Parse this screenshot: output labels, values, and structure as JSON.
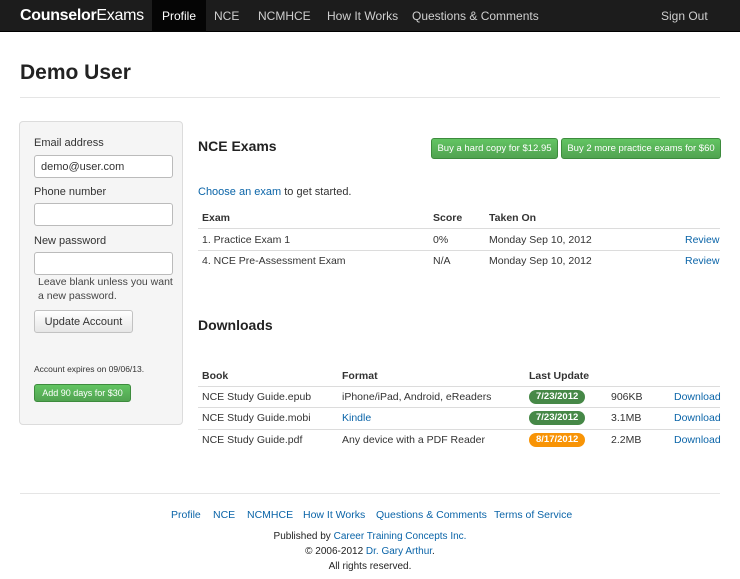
{
  "brand": {
    "bold": "Counselor",
    "light": "Exams"
  },
  "nav": {
    "items": [
      "Profile",
      "NCE",
      "NCMHCE",
      "How It Works",
      "Questions & Comments"
    ],
    "sign_out": "Sign Out"
  },
  "page_title": "Demo User",
  "account_form": {
    "email_label": "Email address",
    "email_value": "demo@user.com",
    "phone_label": "Phone number",
    "phone_value": "",
    "password_label": "New password",
    "password_value": "",
    "password_help": "Leave blank unless you want a new password.",
    "update_button": "Update Account",
    "expires_text": "Account expires on 09/06/13.",
    "add_days_button": "Add 90 days for $30"
  },
  "exams": {
    "title": "NCE Exams",
    "buy_hard_copy": "Buy a hard copy for $12.95",
    "buy_more": "Buy 2 more practice exams for $60",
    "intro_link": "Choose an exam",
    "intro_rest": " to get started.",
    "columns": [
      "Exam",
      "Score",
      "Taken On"
    ],
    "rows": [
      {
        "exam": "1. Practice Exam 1",
        "score": "0%",
        "taken_on": "Monday Sep 10, 2012",
        "action": "Review"
      },
      {
        "exam": "4. NCE Pre-Assessment Exam",
        "score": "N/A",
        "taken_on": "Monday Sep 10, 2012",
        "action": "Review"
      }
    ]
  },
  "downloads": {
    "title": "Downloads",
    "columns": [
      "Book",
      "Format",
      "Last Update"
    ],
    "rows": [
      {
        "book": "NCE Study Guide.epub",
        "format": "iPhone/iPad, Android, eReaders",
        "format_is_link": false,
        "updated": "7/23/2012",
        "badge_color": "#468847",
        "size": "906KB",
        "action": "Download"
      },
      {
        "book": "NCE Study Guide.mobi",
        "format": "Kindle",
        "format_is_link": true,
        "updated": "7/23/2012",
        "badge_color": "#468847",
        "size": "3.1MB",
        "action": "Download"
      },
      {
        "book": "NCE Study Guide.pdf",
        "format": "Any device with a PDF Reader",
        "format_is_link": false,
        "updated": "8/17/2012",
        "badge_color": "#f89406",
        "size": "2.2MB",
        "action": "Download"
      }
    ]
  },
  "footer": {
    "links": [
      "Profile",
      "NCE",
      "NCMHCE",
      "How It Works",
      "Questions & Comments",
      "Terms of Service"
    ],
    "published_prefix": "Published by ",
    "publisher": "Career Training Concepts Inc.",
    "copyright_prefix": "© 2006-2012 ",
    "author": "Dr. Gary Arthur",
    "author_suffix": ".",
    "rights": "All rights reserved."
  },
  "colors": {
    "accent": "#0a64a8",
    "success": "#51a351",
    "navbar": "#1c1c1c"
  }
}
